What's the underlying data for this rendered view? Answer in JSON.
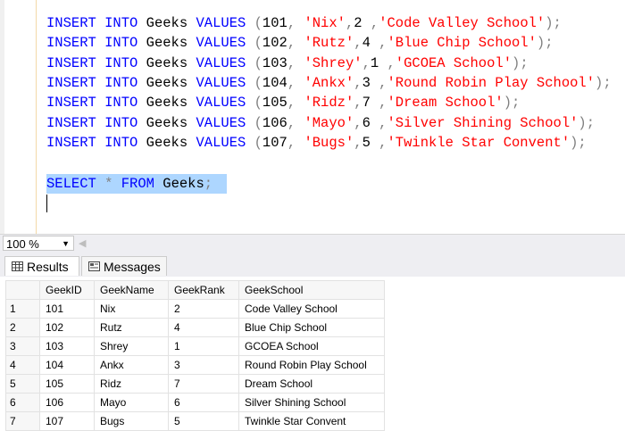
{
  "editor": {
    "insert_lines": [
      {
        "kw1": "INSERT",
        "kw2": "INTO",
        "table": "Geeks",
        "kw3": "VALUES",
        "id": "101",
        "name": "'Nix'",
        "rank": "2",
        "school": "'Code Valley School'"
      },
      {
        "kw1": "INSERT",
        "kw2": "INTO",
        "table": "Geeks",
        "kw3": "VALUES",
        "id": "102",
        "name": "'Rutz'",
        "rank": "4",
        "school": "'Blue Chip School'"
      },
      {
        "kw1": "INSERT",
        "kw2": "INTO",
        "table": "Geeks",
        "kw3": "VALUES",
        "id": "103",
        "name": "'Shrey'",
        "rank": "1",
        "school": "'GCOEA School'"
      },
      {
        "kw1": "INSERT",
        "kw2": "INTO",
        "table": "Geeks",
        "kw3": "VALUES",
        "id": "104",
        "name": "'Ankx'",
        "rank": "3",
        "school": "'Round Robin Play School'"
      },
      {
        "kw1": "INSERT",
        "kw2": "INTO",
        "table": "Geeks",
        "kw3": "VALUES",
        "id": "105",
        "name": "'Ridz'",
        "rank": "7",
        "school": "'Dream School'"
      },
      {
        "kw1": "INSERT",
        "kw2": "INTO",
        "table": "Geeks",
        "kw3": "VALUES",
        "id": "106",
        "name": "'Mayo'",
        "rank": "6",
        "school": "'Silver Shining School'"
      },
      {
        "kw1": "INSERT",
        "kw2": "INTO",
        "table": "Geeks",
        "kw3": "VALUES",
        "id": "107",
        "name": "'Bugs'",
        "rank": "5",
        "school": "'Twinkle Star Convent'"
      }
    ],
    "select_line": {
      "kw1": "SELECT",
      "star": "*",
      "kw2": "FROM",
      "table": "Geeks",
      "end": ";"
    }
  },
  "zoom": {
    "value": "100 %"
  },
  "tabs": {
    "results": "Results",
    "messages": "Messages"
  },
  "grid": {
    "headers": [
      "GeekID",
      "GeekName",
      "GeekRank",
      "GeekSchool"
    ],
    "rows": [
      {
        "n": "1",
        "id": "101",
        "name": "Nix",
        "rank": "2",
        "school": "Code Valley School"
      },
      {
        "n": "2",
        "id": "102",
        "name": "Rutz",
        "rank": "4",
        "school": "Blue Chip School"
      },
      {
        "n": "3",
        "id": "103",
        "name": "Shrey",
        "rank": "1",
        "school": "GCOEA School"
      },
      {
        "n": "4",
        "id": "104",
        "name": "Ankx",
        "rank": "3",
        "school": "Round Robin Play School"
      },
      {
        "n": "5",
        "id": "105",
        "name": "Ridz",
        "rank": "7",
        "school": "Dream School"
      },
      {
        "n": "6",
        "id": "106",
        "name": "Mayo",
        "rank": "6",
        "school": "Silver Shining School"
      },
      {
        "n": "7",
        "id": "107",
        "name": "Bugs",
        "rank": "5",
        "school": "Twinkle Star Convent"
      }
    ]
  },
  "colors": {
    "keyword": "#0000ff",
    "string": "#ff0000",
    "selection": "#add6ff"
  }
}
